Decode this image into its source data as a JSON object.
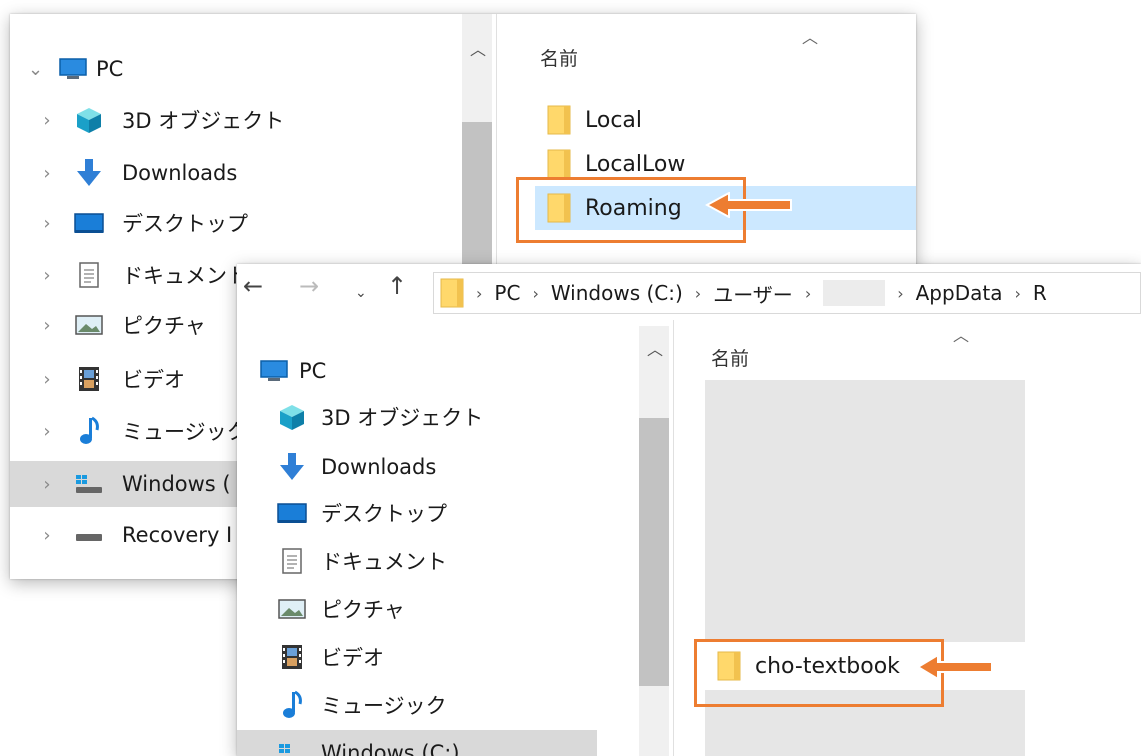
{
  "back_window": {
    "nav": {
      "root": "PC",
      "items": [
        {
          "label": "3D オブジェクト",
          "icon": "3d-objects-icon"
        },
        {
          "label": "Downloads",
          "icon": "downloads-icon"
        },
        {
          "label": "デスクトップ",
          "icon": "desktop-icon"
        },
        {
          "label": "ドキュメント",
          "icon": "documents-icon"
        },
        {
          "label": "ピクチャ",
          "icon": "pictures-icon"
        },
        {
          "label": "ビデオ",
          "icon": "videos-icon"
        },
        {
          "label": "ミュージック",
          "icon": "music-icon"
        },
        {
          "label": "Windows (",
          "icon": "drive-icon",
          "selected": true
        },
        {
          "label": "Recovery I",
          "icon": "recovery-drive-icon"
        }
      ]
    },
    "content": {
      "column_header": "名前",
      "files": [
        {
          "name": "Local"
        },
        {
          "name": "LocalLow"
        },
        {
          "name": "Roaming",
          "selected": true
        }
      ]
    }
  },
  "front_window": {
    "address_bar": {
      "crumbs": [
        "PC",
        "Windows (C:)",
        "ユーザー",
        "",
        "AppData",
        "R"
      ]
    },
    "nav": {
      "root": "PC",
      "items": [
        {
          "label": "3D オブジェクト",
          "icon": "3d-objects-icon"
        },
        {
          "label": "Downloads",
          "icon": "downloads-icon"
        },
        {
          "label": "デスクトップ",
          "icon": "desktop-icon"
        },
        {
          "label": "ドキュメント",
          "icon": "documents-icon"
        },
        {
          "label": "ピクチャ",
          "icon": "pictures-icon"
        },
        {
          "label": "ビデオ",
          "icon": "videos-icon"
        },
        {
          "label": "ミュージック",
          "icon": "music-icon"
        },
        {
          "label": "Windows (C:)",
          "icon": "drive-icon"
        }
      ]
    },
    "content": {
      "column_header": "名前",
      "files": [
        {
          "name": "cho-textbook"
        }
      ]
    }
  },
  "colors": {
    "highlight": "#ed7d31",
    "selection": "#cce8ff",
    "folder": "#ffd86b"
  }
}
